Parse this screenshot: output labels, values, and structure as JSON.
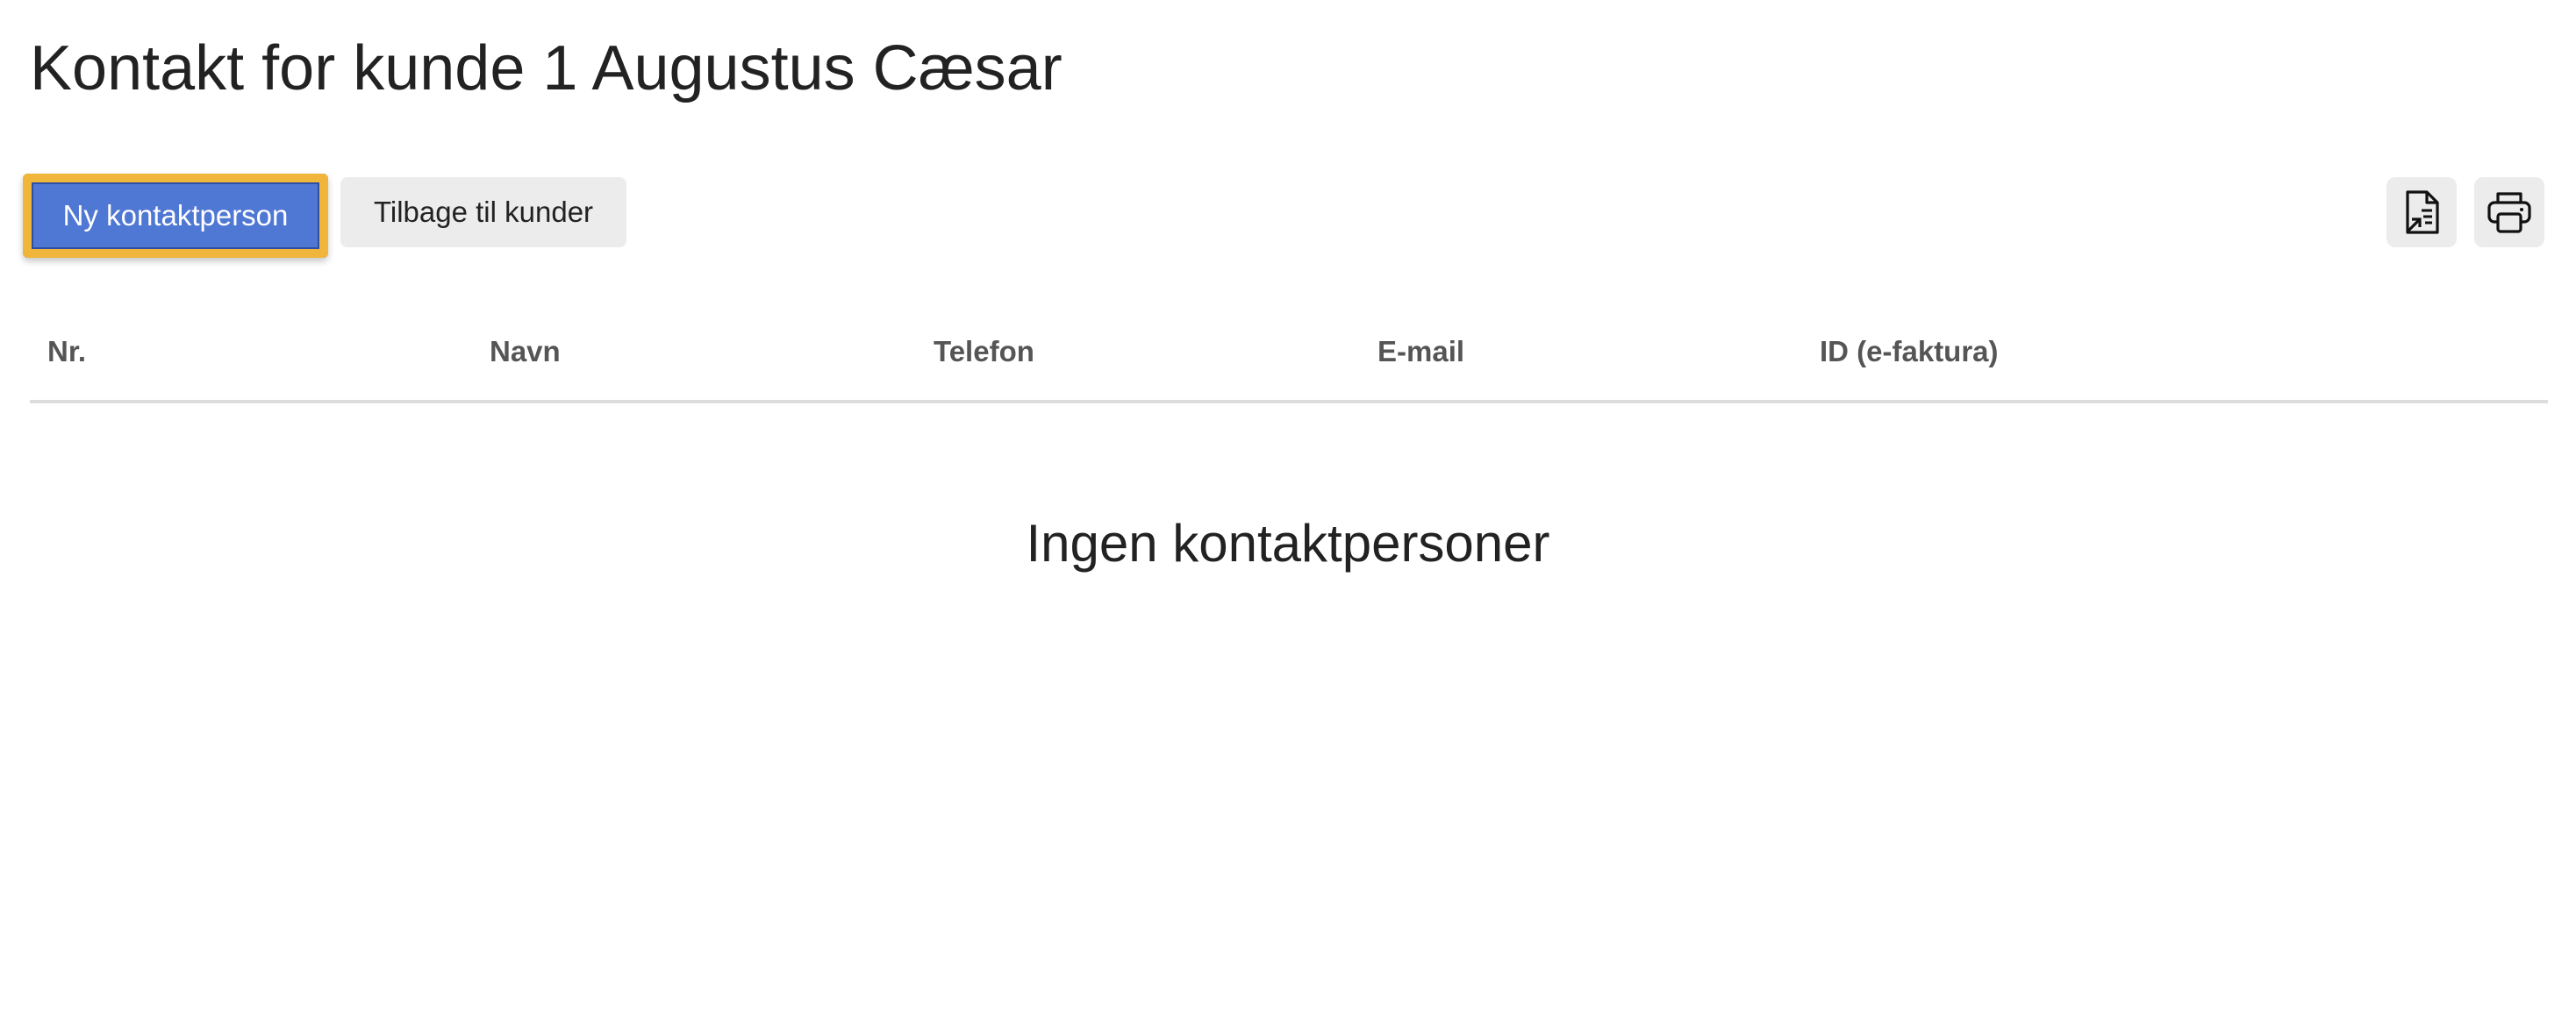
{
  "page": {
    "title": "Kontakt for kunde 1 Augustus Cæsar"
  },
  "toolbar": {
    "new_contact_label": "Ny kontaktperson",
    "back_label": "Tilbage til kunder",
    "export_icon": "file-export-icon",
    "print_icon": "printer-icon"
  },
  "table": {
    "columns": [
      "Nr.",
      "Navn",
      "Telefon",
      "E-mail",
      "ID (e-faktura)"
    ],
    "rows": []
  },
  "empty_state": {
    "message": "Ingen kontaktpersoner"
  },
  "colors": {
    "primary": "#4f77d4",
    "focus_ring": "#f0b63c",
    "secondary_bg": "#ececec",
    "header_text": "#555555",
    "divider": "#dddddd"
  }
}
